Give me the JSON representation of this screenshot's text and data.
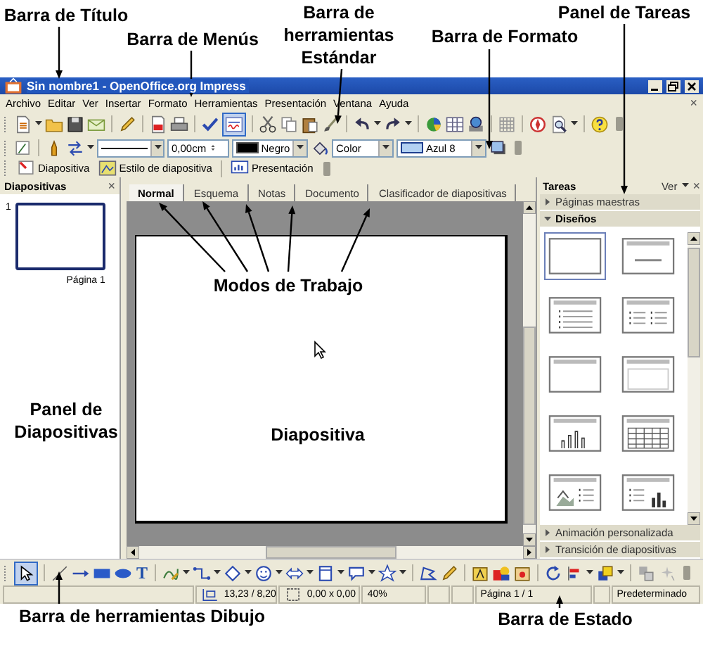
{
  "window": {
    "title": "Sin nombre1 - OpenOffice.org Impress"
  },
  "menu": {
    "items": [
      "Archivo",
      "Editar",
      "Ver",
      "Insertar",
      "Formato",
      "Herramientas",
      "Presentación",
      "Ventana",
      "Ayuda"
    ],
    "close": "×"
  },
  "standard_toolbar": {
    "autospell_on": true
  },
  "format_toolbar": {
    "line_width": "0,00cm",
    "line_color": "Negro",
    "area_style": "Color",
    "area_color": "Azul 8"
  },
  "slide_toolbar": {
    "buttons": [
      "Diapositiva",
      "Estilo de diapositiva",
      "Presentación"
    ]
  },
  "slides_panel": {
    "title": "Diapositivas",
    "close": "×",
    "slides": [
      {
        "number": "1",
        "label": "Página 1",
        "selected": true
      }
    ]
  },
  "view_tabs": [
    {
      "label": "Normal",
      "selected": true
    },
    {
      "label": "Esquema",
      "selected": false
    },
    {
      "label": "Notas",
      "selected": false
    },
    {
      "label": "Documento",
      "selected": false
    },
    {
      "label": "Clasificador de diapositivas",
      "selected": false
    }
  ],
  "task_panel": {
    "title": "Tareas",
    "view": "Ver",
    "close": "×",
    "sections": [
      {
        "label": "Páginas maestras",
        "expanded": false
      },
      {
        "label": "Diseños",
        "expanded": true,
        "layouts": [
          {
            "kind": "blank",
            "selected": true
          },
          {
            "kind": "title-content",
            "selected": false
          },
          {
            "kind": "title-list",
            "selected": false
          },
          {
            "kind": "title-two-lists",
            "selected": false
          },
          {
            "kind": "title-only",
            "selected": false
          },
          {
            "kind": "title-box",
            "selected": false
          },
          {
            "kind": "title-chart",
            "selected": false
          },
          {
            "kind": "title-table",
            "selected": false
          },
          {
            "kind": "picture-list",
            "selected": false
          },
          {
            "kind": "list-chart",
            "selected": false
          }
        ]
      },
      {
        "label": "Animación personalizada",
        "expanded": false
      },
      {
        "label": "Transición de diapositivas",
        "expanded": false
      }
    ]
  },
  "drawing_toolbar": {
    "select_on": true,
    "text_tool": "T"
  },
  "status_bar": {
    "position": "13,23 / 8,20",
    "size": "0,00 x 0,00",
    "zoom": "40%",
    "page": "Página 1 / 1",
    "style": "Predeterminado"
  },
  "annotations": [
    {
      "text": "Barra de Título"
    },
    {
      "text": "Barra de Menús"
    },
    {
      "text": "Barra de herramientas Estándar"
    },
    {
      "text": "Barra de Formato"
    },
    {
      "text": "Panel de Tareas"
    },
    {
      "text": "Modos de Trabajo"
    },
    {
      "text": "Panel de Diapositivas"
    },
    {
      "text": "Diapositiva"
    },
    {
      "text": "Barra de herramientas Dibujo"
    },
    {
      "text": "Barra de Estado"
    }
  ]
}
